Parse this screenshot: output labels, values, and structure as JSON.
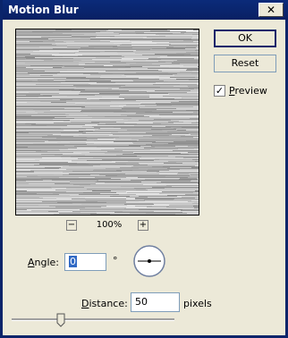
{
  "window": {
    "title": "Motion Blur",
    "close_glyph": "✕"
  },
  "preview": {
    "zoom_out_glyph": "−",
    "zoom_in_glyph": "+",
    "zoom_level": "100%"
  },
  "buttons": {
    "ok": "OK",
    "reset": "Reset"
  },
  "preview_checkbox": {
    "label": "Preview",
    "checked": true,
    "check_glyph": "✓"
  },
  "angle": {
    "label": "Angle:",
    "value": "0",
    "unit": "°"
  },
  "distance": {
    "label": "Distance:",
    "value": "50",
    "unit": "pixels",
    "slider_fraction": 0.29
  },
  "colors": {
    "accent": "#0a246a",
    "selection": "#316ac5"
  }
}
